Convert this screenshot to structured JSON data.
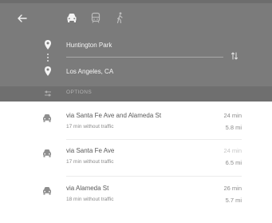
{
  "header": {
    "back_icon": "back-arrow-icon",
    "modes": [
      {
        "name": "driving",
        "icon": "car-icon",
        "selected": true
      },
      {
        "name": "transit",
        "icon": "transit-icon",
        "selected": false
      },
      {
        "name": "walking",
        "icon": "walk-icon",
        "selected": false
      }
    ],
    "origin": "Huntington Park",
    "destination": "Los Angeles, CA",
    "swap_icon": "swap-icon"
  },
  "options": {
    "label": "OPTIONS",
    "icon": "sliders-icon"
  },
  "routes": [
    {
      "title": "via Santa Fe Ave and Alameda St",
      "subtitle": "17 min without traffic",
      "time": "24 min",
      "distance": "5.8 mi"
    },
    {
      "title": "via Santa Fe Ave",
      "subtitle": "17 min without traffic",
      "time": "24 min",
      "distance": "6.5 mi"
    },
    {
      "title": "via Alameda St",
      "subtitle": "18 min without traffic",
      "time": "26 min",
      "distance": "5.7 mi"
    }
  ],
  "colors": {
    "header_bg": "#7b7b7b",
    "options_bg": "#6f6f6f",
    "route_text": "#5a5a5a",
    "secondary_text": "#8a8a8a"
  }
}
